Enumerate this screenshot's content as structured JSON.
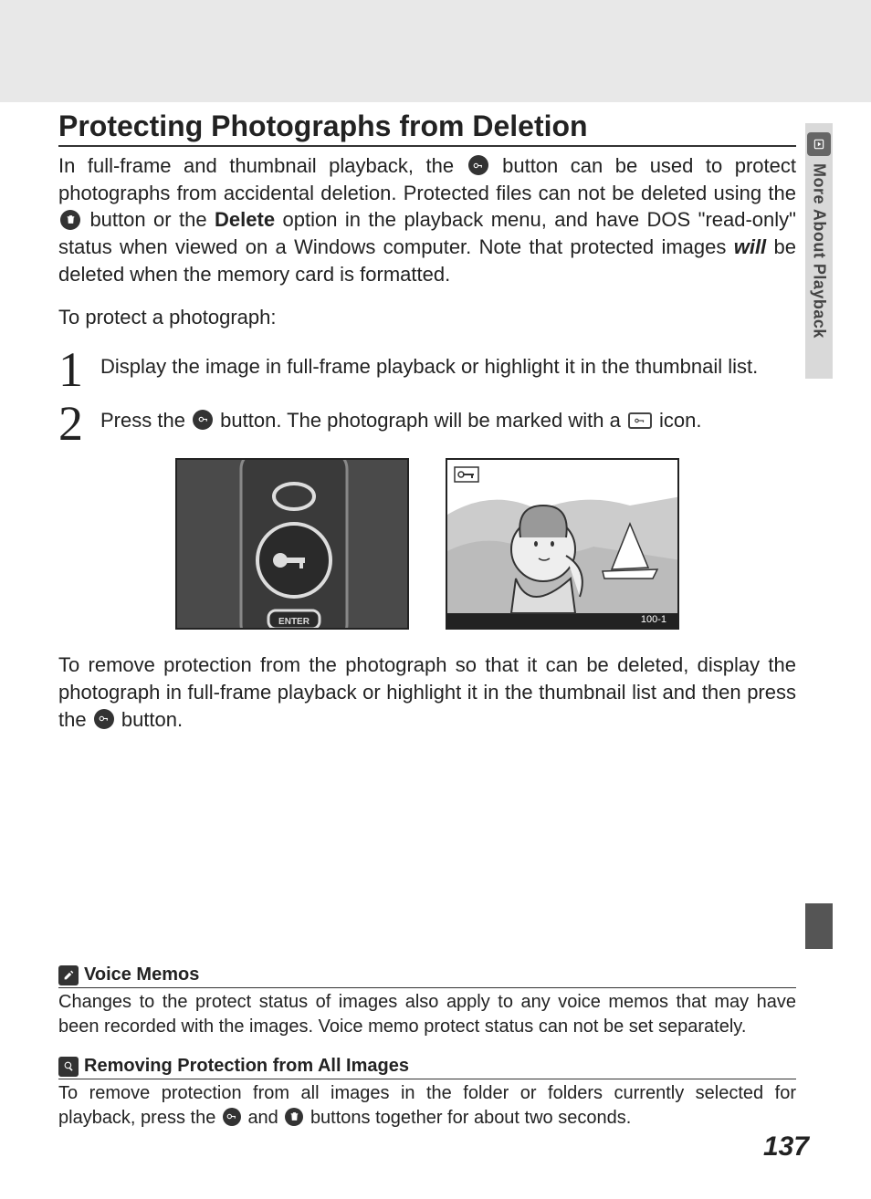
{
  "side_tab": {
    "label": "More About Playback"
  },
  "section": {
    "title": "Protecting Photographs from Deletion",
    "intro_before_icon": "In full-frame and thumbnail playback, the ",
    "intro_after_icon1": " button can be used to protect photographs from accidental deletion.  Protected files can not be deleted using the ",
    "intro_after_icon2": " button or the ",
    "intro_bold": "Delete",
    "intro_after_bold": " option in the playback menu, and have DOS \"read-only\" status when viewed on a Windows computer.  Note that protected images ",
    "intro_will": "will",
    "intro_end": " be deleted when the memory card is formatted.",
    "lead": "To protect a photograph:",
    "step1_num": "1",
    "step1_text": "Display the image in full-frame playback or highlight it in the thumbnail list.",
    "step2_num": "2",
    "step2_before": "Press the ",
    "step2_mid": " button.  The photograph will be marked with a ",
    "step2_after": " icon.",
    "remove_before": "To remove protection from the photograph so that it can be deleted, display the photograph in full-frame playback or highlight it in the thumbnail list and then press the ",
    "remove_after": " button.",
    "fig2_caption": "100-1"
  },
  "notes": {
    "voice_title": "Voice Memos",
    "voice_text": "Changes to the protect status of images also apply to any voice memos that may have been recorded with the images.  Voice memo protect status can not be set separately.",
    "remove_all_title": "Removing Protection from All Images",
    "remove_all_before": "To remove protection from all images in the folder or folders currently selected for playback, press the ",
    "remove_all_mid": " and ",
    "remove_all_after": " buttons together for about two seconds."
  },
  "page_number": "137"
}
